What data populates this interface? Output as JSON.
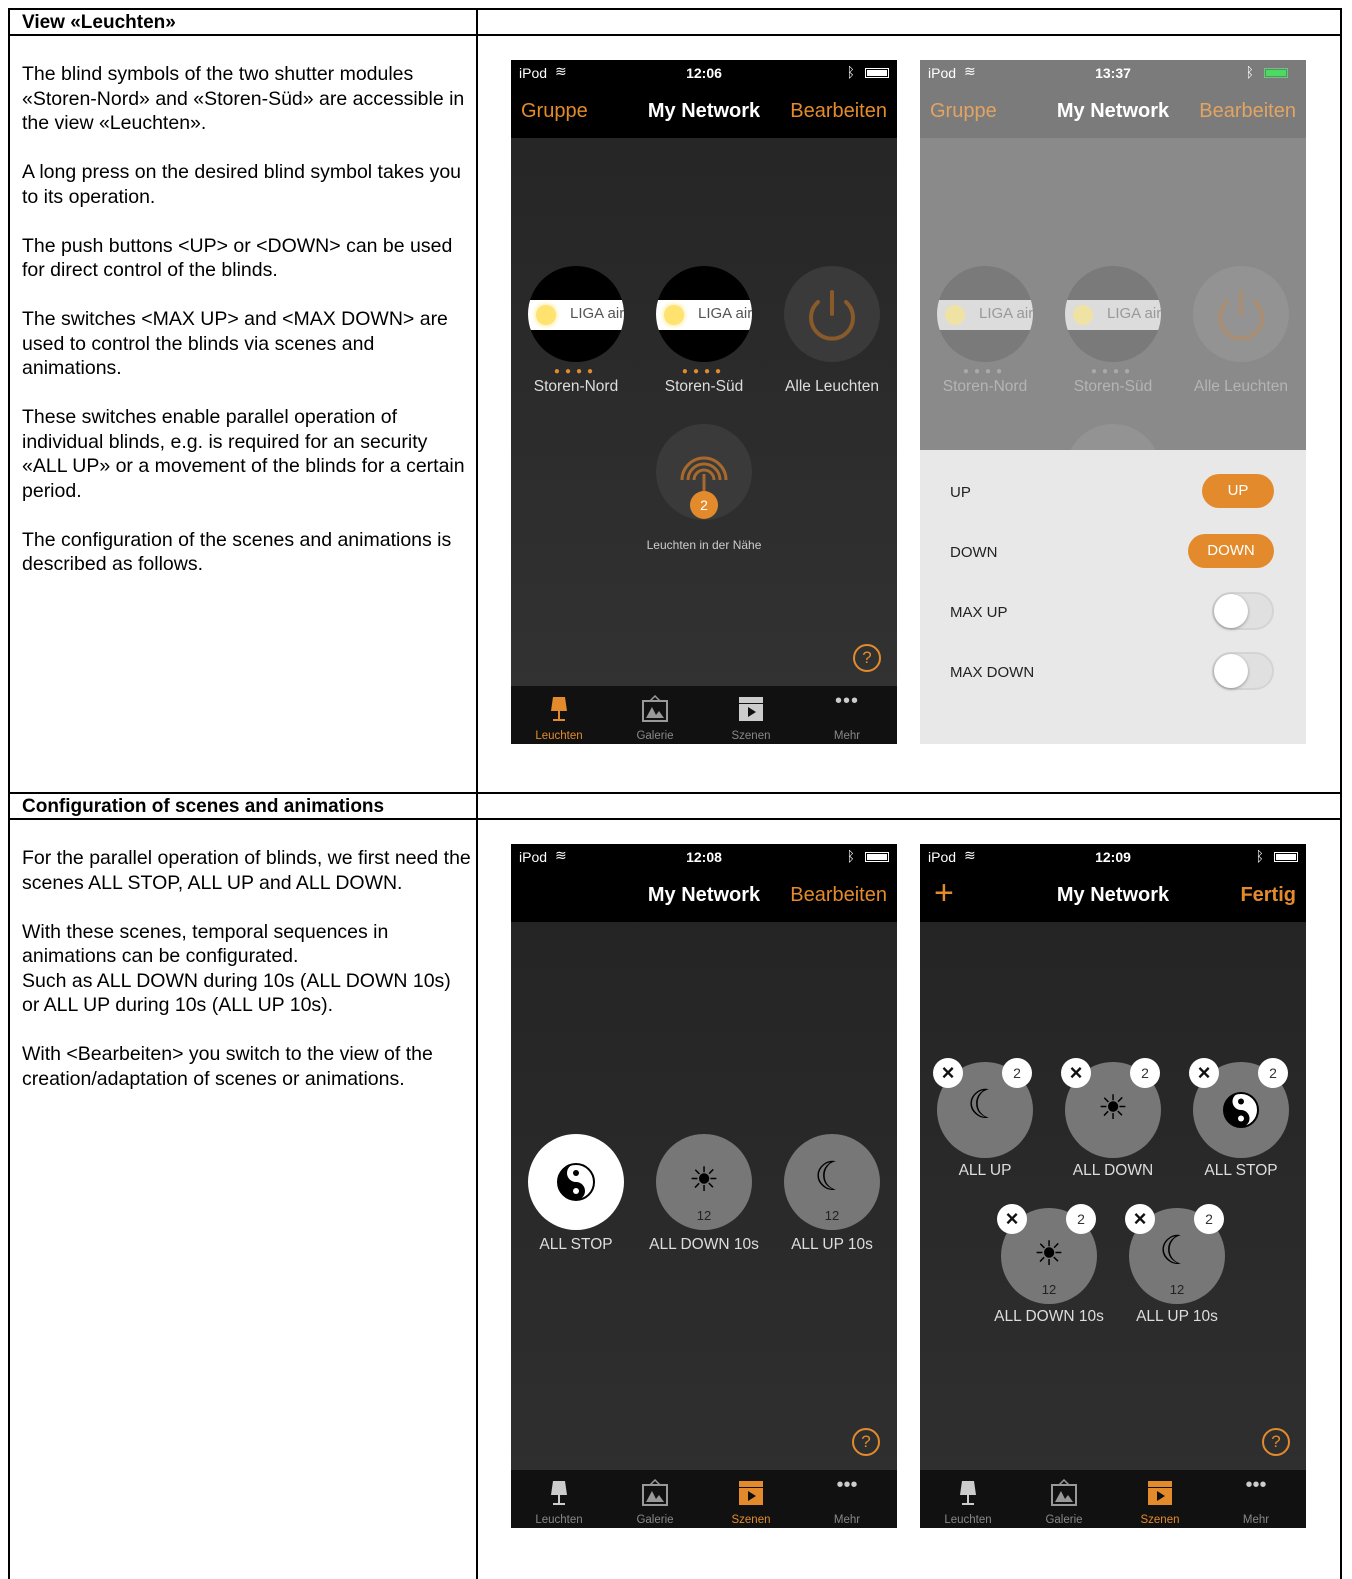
{
  "section1": {
    "header": "View «Leuchten»",
    "paragraphs": [
      "The blind symbols of the two shutter modules «Storen-Nord» and «Storen-Süd» are accessible in the view «Leuchten».",
      "A long press on the desired blind symbol takes you to its operation.",
      "The push buttons <UP> or <DOWN> can be used for direct control of the blinds.",
      "The switches <MAX UP> and <MAX DOWN> are used to control the blinds via scenes and animations.",
      "These switches enable parallel operation of individual blinds, e.g. is required for an security «ALL UP» or a movement of the blinds for a certain period.",
      "The configuration of the scenes and animations is described as follows."
    ]
  },
  "section2": {
    "header": "Configuration of scenes and animations",
    "paragraphs": [
      "For the parallel operation of blinds, we first need the scenes ALL STOP, ALL UP and ALL DOWN.",
      "With these scenes, temporal sequences in animations can be configurated.",
      "Such as ALL DOWN during 10s (ALL DOWN 10s) or ALL UP during 10s (ALL UP 10s).",
      "With <Bearbeiten> you switch to the view of the creation/adaptation of scenes or animations."
    ]
  },
  "common": {
    "carrier": "iPod",
    "title": "My Network",
    "group": "Gruppe",
    "edit": "Bearbeiten",
    "done": "Fertig",
    "lamp_text": "LIGA air",
    "storen_nord": "Storen-Nord",
    "storen_sued": "Storen-Süd",
    "alle_leuchten": "Alle Leuchten",
    "nearby": "Leuchten in der Nähe",
    "nearby_count": "2",
    "tabs": [
      "Leuchten",
      "Galerie",
      "Szenen",
      "Mehr"
    ],
    "all_stop": "ALL STOP",
    "all_up": "ALL UP",
    "all_down": "ALL DOWN",
    "all_down_10s": "ALL  DOWN 10s",
    "all_up_10s": "ALL UP  10s",
    "twelve": "12",
    "two": "2"
  },
  "phone1": {
    "time": "12:06"
  },
  "phone2": {
    "time": "13:37",
    "rows": {
      "up": "UP",
      "down": "DOWN",
      "max_up": "MAX UP",
      "max_down": "MAX DOWN"
    },
    "up_button": "UP",
    "down_button": "DOWN"
  },
  "phone3": {
    "time": "12:08"
  },
  "phone4": {
    "time": "12:09"
  },
  "colors": {
    "accent": "#e38b2c",
    "dark_bg": "#262626",
    "sheet_bg": "#e8e8e8"
  }
}
